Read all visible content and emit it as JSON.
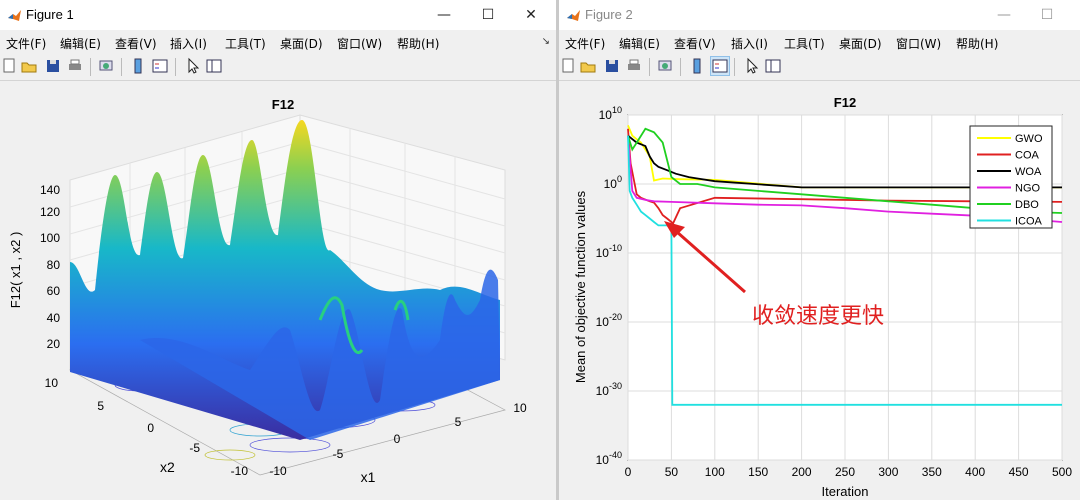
{
  "figure1": {
    "title": "Figure 1",
    "menu": [
      "文件(F)",
      "编辑(E)",
      "查看(V)",
      "插入(I)",
      "工具(T)",
      "桌面(D)",
      "窗口(W)",
      "帮助(H)"
    ],
    "plot": {
      "title": "F12",
      "zlabel": "F12( x1 , x2 )",
      "xlabel": "x1",
      "ylabel": "x2",
      "zticks": [
        "20",
        "40",
        "60",
        "80",
        "100",
        "120",
        "140"
      ],
      "xticks": [
        "-10",
        "-5",
        "0",
        "5",
        "10"
      ],
      "yticks": [
        "10",
        "5",
        "0",
        "-5",
        "-10"
      ]
    }
  },
  "figure2": {
    "title": "Figure 2",
    "menu": [
      "文件(F)",
      "编辑(E)",
      "查看(V)",
      "插入(I)",
      "工具(T)",
      "桌面(D)",
      "窗口(W)",
      "帮助(H)"
    ],
    "annotation": "收敛速度更快",
    "chart_data": {
      "type": "line",
      "title": "F12",
      "xlabel": "Iteration",
      "ylabel": "Mean of objective function values",
      "xlim": [
        0,
        500
      ],
      "ylim": [
        "1e-40",
        "1e10"
      ],
      "yscale": "log",
      "xticks": [
        0,
        50,
        100,
        150,
        200,
        250,
        300,
        350,
        400,
        450,
        500
      ],
      "ytick_exponents": [
        "10",
        "0",
        "-10",
        "-20",
        "-30",
        "-40"
      ],
      "grid": true,
      "legend_position": "top-right",
      "series": [
        {
          "name": "GWO",
          "color": "#ffff00",
          "x": [
            0,
            5,
            15,
            25,
            30,
            40,
            60,
            100,
            200,
            500
          ],
          "log10y": [
            8.5,
            7,
            6,
            4,
            0.5,
            0.8,
            0.7,
            0.6,
            -0.5,
            -0.5
          ]
        },
        {
          "name": "COA",
          "color": "#e02020",
          "x": [
            0,
            3,
            10,
            15,
            25,
            30,
            35,
            40,
            45,
            50,
            52,
            60,
            100,
            200,
            300,
            400,
            500
          ],
          "log10y": [
            8,
            3,
            -1.5,
            -2,
            -2.5,
            -2.7,
            -3.5,
            -4.5,
            -5,
            -5.5,
            -5.7,
            -3.5,
            -2,
            -2.2,
            -2.4,
            -2.5,
            -2.6
          ]
        },
        {
          "name": "WOA",
          "color": "#000000",
          "x": [
            0,
            10,
            20,
            25,
            30,
            35,
            45,
            55,
            70,
            80,
            100,
            200,
            300,
            400,
            500
          ],
          "log10y": [
            7,
            6,
            5.5,
            4,
            3,
            2.5,
            2,
            1.5,
            1,
            0.8,
            0.4,
            -0.5,
            -0.5,
            -0.5,
            -0.5
          ]
        },
        {
          "name": "NGO",
          "color": "#e020e0",
          "x": [
            0,
            5,
            10,
            20,
            30,
            50,
            100,
            150,
            200,
            250,
            300,
            350,
            400,
            450,
            500
          ],
          "log10y": [
            7,
            -1,
            -2,
            -2.3,
            -2.5,
            -2.6,
            -2.8,
            -3,
            -3.1,
            -3.5,
            -4,
            -4.3,
            -4.6,
            -5,
            -5.5
          ]
        },
        {
          "name": "DBO",
          "color": "#20d020",
          "x": [
            0,
            5,
            10,
            20,
            30,
            40,
            50,
            60,
            80,
            100,
            150,
            200,
            250,
            300,
            350,
            400,
            450,
            500
          ],
          "log10y": [
            7,
            5,
            6,
            8,
            7.5,
            6,
            1,
            0,
            0,
            -0.5,
            -1,
            -1.5,
            -2,
            -2.5,
            -3,
            -3.5,
            -4,
            -4.2
          ]
        },
        {
          "name": "ICOA",
          "color": "#20e0e0",
          "x": [
            0,
            2,
            5,
            10,
            15,
            20,
            25,
            30,
            35,
            40,
            45,
            50,
            51,
            500
          ],
          "log10y": [
            7,
            -1,
            -2,
            -3,
            -4,
            -4.5,
            -5,
            -5.5,
            -6,
            -6,
            -6,
            -6.5,
            -32,
            -32
          ]
        }
      ]
    }
  }
}
